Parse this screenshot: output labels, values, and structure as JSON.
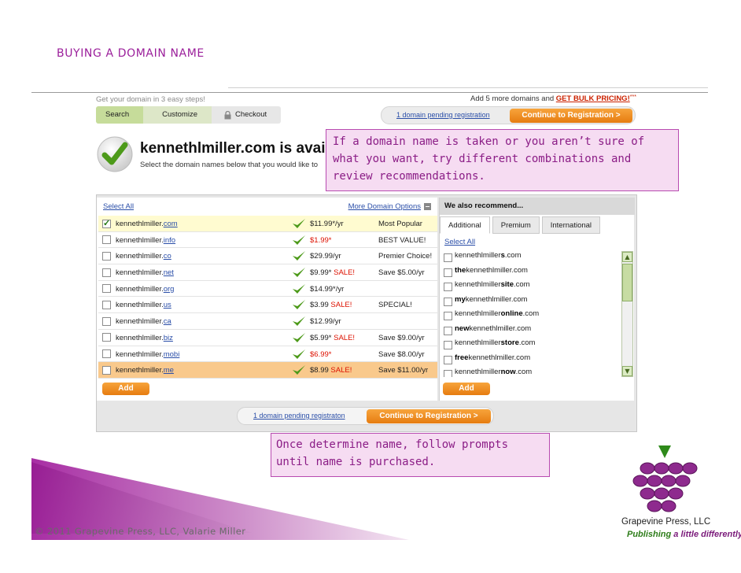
{
  "slide": {
    "title": "BUYING A DOMAIN NAME",
    "footer": "© 2011 Grapevine Press, LLC, Valarie Miller"
  },
  "header": {
    "steps_label": "Get your domain in 3 easy steps!",
    "bulk_prefix": "Add 5 more domains and ",
    "bulk_link": "GET BULK PRICING!",
    "bulk_note": "***",
    "steps": [
      "Search",
      "Customize",
      "Checkout"
    ],
    "pending_link": "1 domain pending registration",
    "continue_label": "Continue to Registration >"
  },
  "result": {
    "domain_visible": "kennethlmiller.com is avail",
    "instruction_visible": "Select the domain names below that you would like to"
  },
  "callouts": {
    "top": "If a domain name is taken or you aren’t sure of what you want, try different combinations and review recommendations.",
    "bottom": "Once determine name, follow prompts until name is purchased."
  },
  "left_panel": {
    "select_all": "Select All",
    "more_options": "More Domain Options",
    "add_label": "Add",
    "rows": [
      {
        "base": "kennethlmiller.",
        "ext": "com",
        "price": "$11.99*/yr",
        "price_sale": "",
        "note": "Most Popular",
        "checked": true,
        "state": "selected"
      },
      {
        "base": "kennethlmiller.",
        "ext": "info",
        "price": "",
        "price_sale": "$1.99*",
        "note": "BEST VALUE!",
        "checked": false,
        "state": ""
      },
      {
        "base": "kennethlmiller.",
        "ext": "co",
        "price": "$29.99/yr",
        "price_sale": "",
        "note": "Premier Choice!",
        "checked": false,
        "state": ""
      },
      {
        "base": "kennethlmiller.",
        "ext": "net",
        "price": "$9.99* ",
        "price_sale": "SALE!",
        "note": "Save $5.00/yr",
        "checked": false,
        "state": ""
      },
      {
        "base": "kennethlmiller.",
        "ext": "org",
        "price": "$14.99*/yr",
        "price_sale": "",
        "note": "",
        "checked": false,
        "state": ""
      },
      {
        "base": "kennethlmiller.",
        "ext": "us",
        "price": "$3.99 ",
        "price_sale": "SALE!",
        "note": "SPECIAL!",
        "checked": false,
        "state": ""
      },
      {
        "base": "kennethlmiller.",
        "ext": "ca",
        "price": "$12.99/yr",
        "price_sale": "",
        "note": "",
        "checked": false,
        "state": ""
      },
      {
        "base": "kennethlmiller.",
        "ext": "biz",
        "price": "$5.99* ",
        "price_sale": "SALE!",
        "note": "Save $9.00/yr",
        "checked": false,
        "state": ""
      },
      {
        "base": "kennethlmiller.",
        "ext": "mobi",
        "price": "",
        "price_sale": "$6.99*",
        "note": "Save $8.00/yr",
        "checked": false,
        "state": ""
      },
      {
        "base": "kennethlmiller.",
        "ext": "me",
        "price": "$8.99 ",
        "price_sale": "SALE!",
        "note": "Save $11.00/yr",
        "checked": false,
        "state": "hover"
      }
    ]
  },
  "right_panel": {
    "title": "We also recommend...",
    "tabs": [
      "Additional",
      "Premium",
      "International"
    ],
    "active_tab": 0,
    "select_all": "Select All",
    "add_label": "Add",
    "items": [
      {
        "pre": "kennethlmiller",
        "bold": "s",
        "post": ".com"
      },
      {
        "pre": "",
        "bold": "the",
        "post": "kennethlmiller.com"
      },
      {
        "pre": "kennethlmiller",
        "bold": "site",
        "post": ".com"
      },
      {
        "pre": "",
        "bold": "my",
        "post": "kennethlmiller.com"
      },
      {
        "pre": "kennethlmiller",
        "bold": "online",
        "post": ".com"
      },
      {
        "pre": "",
        "bold": "new",
        "post": "kennethlmiller.com"
      },
      {
        "pre": "kennethlmiller",
        "bold": "store",
        "post": ".com"
      },
      {
        "pre": "",
        "bold": "free",
        "post": "kennethlmiller.com"
      },
      {
        "pre": "kennethlmiller",
        "bold": "now",
        "post": ".com"
      }
    ]
  },
  "bottom_bar": {
    "pending_link": "1 domain pending registraton",
    "continue_label": "Continue to Registration >"
  },
  "brand": {
    "name": "Grapevine Press, LLC",
    "tag_start": "Publishing ",
    "tag_em": "a little differently"
  },
  "colors": {
    "accent_purple": "#9b1f9b",
    "callout_fill": "#f6dcf2",
    "orange_button": "#e67c10",
    "check_green": "#4d9a1a"
  }
}
